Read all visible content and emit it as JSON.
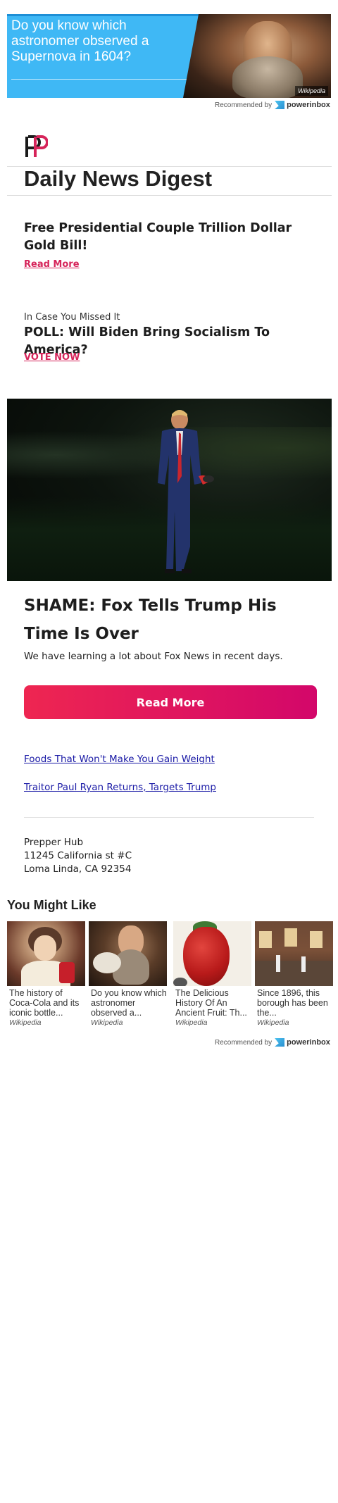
{
  "top_ad": {
    "text": "Do you know which astronomer observed a Supernova in 1604?",
    "source": "Wikipedia"
  },
  "recommended": {
    "label": "Recommended by",
    "brand": "powerinbox"
  },
  "newsletter": {
    "title": "Daily News Digest"
  },
  "story1": {
    "headline": "Free Presidential Couple Trillion Dollar Gold Bill!",
    "link": "Read More"
  },
  "story2": {
    "kicker": "In Case You Missed It",
    "headline": "POLL: Will Biden Bring Socialism To America?",
    "link": "VOTE NOW"
  },
  "feature": {
    "headline": "SHAME: Fox Tells Trump His Time Is Over",
    "lede": "We have learning a lot about Fox News in recent days.",
    "button": "Read More"
  },
  "links": [
    "Foods That Won't Make You Gain Weight",
    "Traitor Paul Ryan Returns, Targets Trump"
  ],
  "address": {
    "line1": "Prepper Hub",
    "line2": "11245 California st #C",
    "line3": "Loma Linda, CA 92354"
  },
  "you_might_like": {
    "title": "You Might Like",
    "cards": [
      {
        "caption": "The history of Coca-Cola and its iconic bottle...",
        "source": "Wikipedia"
      },
      {
        "caption": "Do you know which astronomer observed a...",
        "source": "Wikipedia"
      },
      {
        "caption": "The Delicious History Of An Ancient Fruit: Th...",
        "source": "Wikipedia"
      },
      {
        "caption": "Since 1896, this borough has been the...",
        "source": "Wikipedia"
      }
    ]
  },
  "colors": {
    "accent_red": "#d6245a",
    "button_gradient_start": "#ee2651",
    "button_gradient_end": "#d3076a",
    "link_blue": "#1a1aa6",
    "ad_blue": "#3fb8f5"
  },
  "icons": [
    "publisher-logo-icon",
    "powerinbox-logo-icon"
  ]
}
